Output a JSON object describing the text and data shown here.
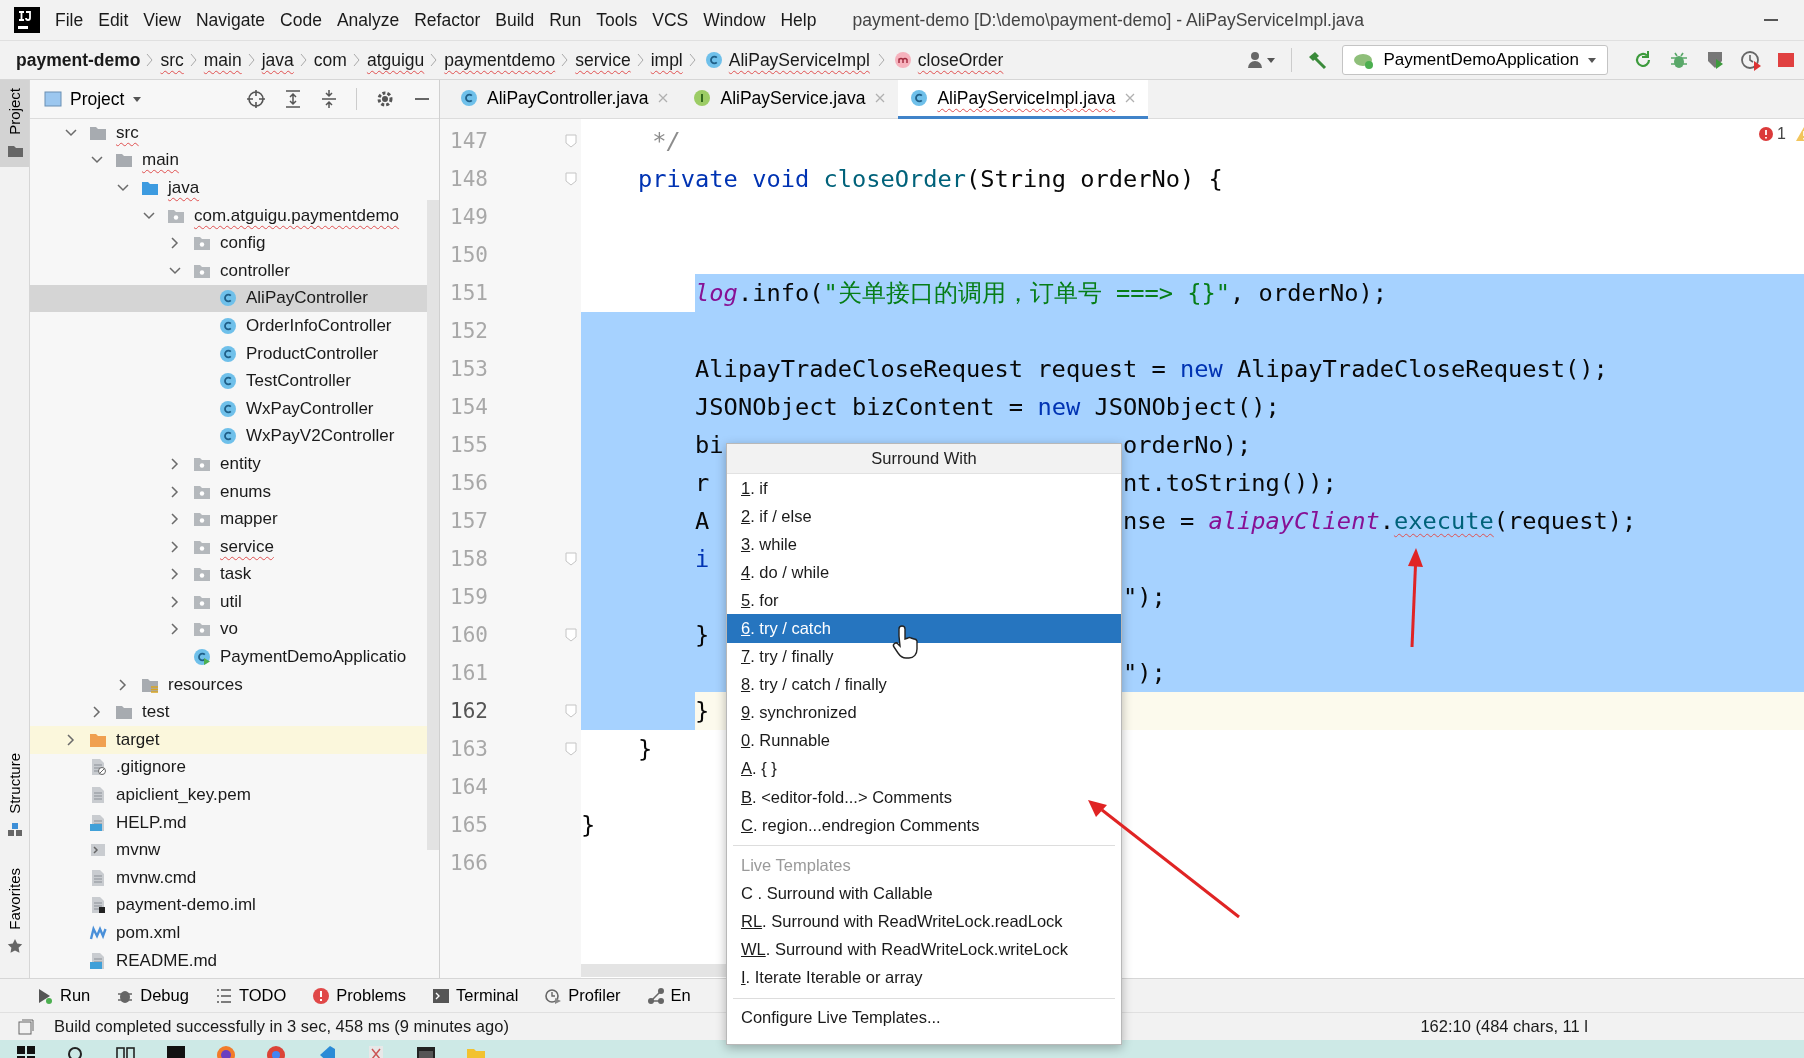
{
  "menu_bar": {
    "items": [
      "File",
      "Edit",
      "View",
      "Navigate",
      "Code",
      "Analyze",
      "Refactor",
      "Build",
      "Run",
      "Tools",
      "VCS",
      "Window",
      "Help"
    ],
    "title": "payment-demo [D:\\demo\\payment-demo] - AliPayServiceImpl.java"
  },
  "breadcrumbs": [
    {
      "label": "payment-demo",
      "kind": "project",
      "underlined": false
    },
    {
      "label": "src",
      "kind": "dir",
      "underlined": true
    },
    {
      "label": "main",
      "kind": "dir",
      "underlined": true
    },
    {
      "label": "java",
      "kind": "dir",
      "underlined": true
    },
    {
      "label": "com",
      "kind": "dir",
      "underlined": false
    },
    {
      "label": "atguigu",
      "kind": "dir",
      "underlined": true
    },
    {
      "label": "paymentdemo",
      "kind": "dir",
      "underlined": true
    },
    {
      "label": "service",
      "kind": "dir",
      "underlined": true
    },
    {
      "label": "impl",
      "kind": "dir",
      "underlined": true
    },
    {
      "label": "AliPayServiceImpl",
      "kind": "class",
      "underlined": true
    },
    {
      "label": "closeOrder",
      "kind": "method",
      "underlined": true
    }
  ],
  "run_config": {
    "label": "PaymentDemoApplication"
  },
  "tool_stripe": [
    {
      "label": "Project",
      "kind": "project",
      "selected": true
    },
    {
      "label": "Structure",
      "kind": "structure",
      "selected": false
    },
    {
      "label": "Favorites",
      "kind": "favorites",
      "selected": false
    }
  ],
  "project_panel": {
    "title": "Project",
    "tree": [
      {
        "label": "src",
        "kind": "folder",
        "expanded": true,
        "selected": false,
        "highlighted": false,
        "underlined": true,
        "children": [
          {
            "label": "main",
            "kind": "folder",
            "expanded": true,
            "selected": false,
            "highlighted": false,
            "underlined": true,
            "children": [
              {
                "label": "java",
                "kind": "source_folder",
                "expanded": true,
                "selected": false,
                "highlighted": false,
                "underlined": true,
                "children": [
                  {
                    "label": "com.atguigu.paymentdemo",
                    "kind": "package",
                    "expanded": true,
                    "selected": false,
                    "highlighted": false,
                    "underlined": true,
                    "children": [
                      {
                        "label": "config",
                        "kind": "package",
                        "expanded": false,
                        "selected": false,
                        "highlighted": false,
                        "underlined": false
                      },
                      {
                        "label": "controller",
                        "kind": "package",
                        "expanded": true,
                        "selected": false,
                        "highlighted": false,
                        "underlined": false,
                        "children": [
                          {
                            "label": "AliPayController",
                            "kind": "class",
                            "selected": true,
                            "highlighted": false,
                            "underlined": false
                          },
                          {
                            "label": "OrderInfoController",
                            "kind": "class",
                            "selected": false,
                            "highlighted": false,
                            "underlined": false
                          },
                          {
                            "label": "ProductController",
                            "kind": "class",
                            "selected": false,
                            "highlighted": false,
                            "underlined": false
                          },
                          {
                            "label": "TestController",
                            "kind": "class",
                            "selected": false,
                            "highlighted": false,
                            "underlined": false
                          },
                          {
                            "label": "WxPayController",
                            "kind": "class",
                            "selected": false,
                            "highlighted": false,
                            "underlined": false
                          },
                          {
                            "label": "WxPayV2Controller",
                            "kind": "class",
                            "selected": false,
                            "highlighted": false,
                            "underlined": false
                          }
                        ]
                      },
                      {
                        "label": "entity",
                        "kind": "package",
                        "expanded": false,
                        "selected": false,
                        "highlighted": false,
                        "underlined": false
                      },
                      {
                        "label": "enums",
                        "kind": "package",
                        "expanded": false,
                        "selected": false,
                        "highlighted": false,
                        "underlined": false
                      },
                      {
                        "label": "mapper",
                        "kind": "package",
                        "expanded": false,
                        "selected": false,
                        "highlighted": false,
                        "underlined": false
                      },
                      {
                        "label": "service",
                        "kind": "package",
                        "expanded": false,
                        "selected": false,
                        "highlighted": false,
                        "underlined": true
                      },
                      {
                        "label": "task",
                        "kind": "package",
                        "expanded": false,
                        "selected": false,
                        "highlighted": false,
                        "underlined": false
                      },
                      {
                        "label": "util",
                        "kind": "package",
                        "expanded": false,
                        "selected": false,
                        "highlighted": false,
                        "underlined": false
                      },
                      {
                        "label": "vo",
                        "kind": "package",
                        "expanded": false,
                        "selected": false,
                        "highlighted": false,
                        "underlined": false
                      },
                      {
                        "label": "PaymentDemoApplicatio",
                        "kind": "app_class",
                        "selected": false,
                        "highlighted": false,
                        "underlined": false
                      }
                    ]
                  }
                ]
              },
              {
                "label": "resources",
                "kind": "resources_folder",
                "expanded": false,
                "selected": false,
                "highlighted": false,
                "underlined": false
              }
            ]
          },
          {
            "label": "test",
            "kind": "folder",
            "expanded": false,
            "selected": false,
            "highlighted": false,
            "underlined": false
          }
        ]
      },
      {
        "label": "target",
        "kind": "excluded_folder",
        "expanded": false,
        "selected": false,
        "highlighted": true,
        "underlined": false
      },
      {
        "label": ".gitignore",
        "kind": "ignore_file",
        "selected": false,
        "highlighted": false,
        "underlined": false
      },
      {
        "label": "apiclient_key.pem",
        "kind": "text_file",
        "selected": false,
        "highlighted": false,
        "underlined": false
      },
      {
        "label": "HELP.md",
        "kind": "markdown_file",
        "selected": false,
        "highlighted": false,
        "underlined": false
      },
      {
        "label": "mvnw",
        "kind": "script_file",
        "selected": false,
        "highlighted": false,
        "underlined": false
      },
      {
        "label": "mvnw.cmd",
        "kind": "text_file",
        "selected": false,
        "highlighted": false,
        "underlined": false
      },
      {
        "label": "payment-demo.iml",
        "kind": "module_file",
        "selected": false,
        "highlighted": false,
        "underlined": false
      },
      {
        "label": "pom.xml",
        "kind": "maven_file",
        "selected": false,
        "highlighted": false,
        "underlined": false
      },
      {
        "label": "README.md",
        "kind": "markdown_file",
        "selected": false,
        "highlighted": false,
        "underlined": false
      }
    ]
  },
  "editor_tabs": [
    {
      "label": "AliPayController.java",
      "kind": "class",
      "selected": false,
      "underlined": false
    },
    {
      "label": "AliPayService.java",
      "kind": "interface",
      "selected": false,
      "underlined": false
    },
    {
      "label": "AliPayServiceImpl.java",
      "kind": "class",
      "selected": true,
      "underlined": true
    }
  ],
  "editor": {
    "problems_count": "1",
    "lines": [
      {
        "number": "147",
        "fold": true,
        "indent_selected": false,
        "text_selected": false,
        "current": false,
        "tokens": [
          {
            "text": "     */",
            "kind": "comment"
          }
        ]
      },
      {
        "number": "148",
        "fold": true,
        "indent_selected": false,
        "text_selected": false,
        "current": false,
        "tokens": [
          {
            "text": "    private",
            "kind": "keyword"
          },
          {
            "text": " void",
            "kind": "keyword"
          },
          {
            "text": " closeOrder",
            "kind": "method"
          },
          {
            "text": "(String orderNo) {",
            "kind": "plain"
          }
        ]
      },
      {
        "number": "149",
        "fold": false,
        "indent_selected": false,
        "text_selected": false,
        "current": false
      },
      {
        "number": "150",
        "fold": false,
        "indent_selected": false,
        "text_selected": false,
        "current": false
      },
      {
        "number": "151",
        "fold": false,
        "indent_selected": false,
        "text_selected": true,
        "current": false,
        "tokens": [
          {
            "text": "        log",
            "kind": "field"
          },
          {
            "text": ".info(",
            "kind": "plain"
          },
          {
            "text": "\"关单接口的调用，订单号 ===> {}\"",
            "kind": "string"
          },
          {
            "text": ", orderNo);",
            "kind": "plain"
          }
        ]
      },
      {
        "number": "152",
        "fold": false,
        "indent_selected": true,
        "text_selected": true,
        "current": false
      },
      {
        "number": "153",
        "fold": false,
        "indent_selected": true,
        "text_selected": true,
        "current": false,
        "tokens": [
          {
            "text": "        AlipayTradeCloseRequest request = ",
            "kind": "plain"
          },
          {
            "text": "new",
            "kind": "keyword"
          },
          {
            "text": " AlipayTradeCloseRequest();",
            "kind": "plain"
          }
        ]
      },
      {
        "number": "154",
        "fold": false,
        "indent_selected": true,
        "text_selected": true,
        "current": false,
        "tokens": [
          {
            "text": "        JSONObject bizContent = ",
            "kind": "plain"
          },
          {
            "text": "new",
            "kind": "keyword"
          },
          {
            "text": " JSONObject();",
            "kind": "plain"
          }
        ]
      },
      {
        "number": "155",
        "fold": false,
        "indent_selected": true,
        "text_selected": true,
        "current": false,
        "tokens": [
          {
            "text": "        bi",
            "kind": "plain"
          },
          {
            "text": "                            orderNo);",
            "kind": "plain"
          }
        ]
      },
      {
        "number": "156",
        "fold": false,
        "indent_selected": true,
        "text_selected": true,
        "current": false,
        "tokens": [
          {
            "text": "        r",
            "kind": "plain"
          },
          {
            "text": "                             nt.toString());",
            "kind": "plain"
          }
        ]
      },
      {
        "number": "157",
        "fold": false,
        "indent_selected": true,
        "text_selected": true,
        "current": false,
        "tokens": [
          {
            "text": "        A",
            "kind": "plain"
          },
          {
            "text": "                             nse = ",
            "kind": "plain"
          },
          {
            "text": "alipayClient",
            "kind": "field"
          },
          {
            "text": ".",
            "kind": "plain"
          },
          {
            "text": "execute",
            "kind": "method_error"
          },
          {
            "text": "(request);",
            "kind": "plain"
          }
        ]
      },
      {
        "number": "158",
        "fold": true,
        "indent_selected": true,
        "text_selected": true,
        "current": false,
        "tokens": [
          {
            "text": "        i",
            "kind": "keyword"
          }
        ]
      },
      {
        "number": "159",
        "fold": false,
        "indent_selected": true,
        "text_selected": true,
        "current": false,
        "tokens": [
          {
            "text": "                                      \");",
            "kind": "plain"
          }
        ]
      },
      {
        "number": "160",
        "fold": true,
        "indent_selected": true,
        "text_selected": true,
        "current": false,
        "tokens": [
          {
            "text": "        }",
            "kind": "plain"
          }
        ]
      },
      {
        "number": "161",
        "fold": false,
        "indent_selected": true,
        "text_selected": true,
        "current": false,
        "tokens": [
          {
            "text": "                                      \");",
            "kind": "plain"
          }
        ]
      },
      {
        "number": "162",
        "fold": true,
        "indent_selected": true,
        "text_selected": false,
        "current": true,
        "tokens": [
          {
            "text": "        }",
            "kind": "plain"
          }
        ]
      },
      {
        "number": "163",
        "fold": true,
        "indent_selected": false,
        "text_selected": false,
        "current": false,
        "tokens": [
          {
            "text": "    }",
            "kind": "plain"
          }
        ]
      },
      {
        "number": "164",
        "fold": false,
        "indent_selected": false,
        "text_selected": false,
        "current": false
      },
      {
        "number": "165",
        "fold": false,
        "text_selected": false,
        "current": false,
        "tokens": [
          {
            "text": "}",
            "kind": "plain"
          }
        ]
      },
      {
        "number": "166",
        "fold": false,
        "indent_selected": false,
        "text_selected": false,
        "current": false
      }
    ]
  },
  "popup": {
    "title": "Surround With",
    "items": [
      {
        "mnemonic": "1",
        "text": ". if",
        "underlined": true,
        "selected": false
      },
      {
        "mnemonic": "2",
        "text": ". if / else",
        "underlined": true,
        "selected": false
      },
      {
        "mnemonic": "3",
        "text": ". while",
        "underlined": true,
        "selected": false
      },
      {
        "mnemonic": "4",
        "text": ". do / while",
        "underlined": true,
        "selected": false
      },
      {
        "mnemonic": "5",
        "text": ". for",
        "underlined": true,
        "selected": false
      },
      {
        "mnemonic": "6",
        "text": ". try / catch",
        "underlined": true,
        "selected": true
      },
      {
        "mnemonic": "7",
        "text": ". try / finally",
        "underlined": true,
        "selected": false
      },
      {
        "mnemonic": "8",
        "text": ". try / catch / finally",
        "underlined": true,
        "selected": false
      },
      {
        "mnemonic": "9",
        "text": ". synchronized",
        "underlined": true,
        "selected": false
      },
      {
        "mnemonic": "0",
        "text": ". Runnable",
        "underlined": true,
        "selected": false
      },
      {
        "mnemonic": "A",
        "text": ". { }",
        "underlined": true,
        "selected": false
      },
      {
        "mnemonic": "B",
        "text": ". <editor-fold...> Comments",
        "underlined": true,
        "selected": false
      },
      {
        "mnemonic": "C",
        "text": ". region...endregion Comments",
        "underlined": true,
        "selected": false
      }
    ],
    "section": "Live Templates",
    "template_items": [
      {
        "mnemonic": "C",
        "text": " . Surround with Callable",
        "underlined": false,
        "selected": false
      },
      {
        "mnemonic": "RL",
        "text": ". Surround with ReadWriteLock.readLock",
        "underlined": true,
        "selected": false
      },
      {
        "mnemonic": "WL",
        "text": ". Surround with ReadWriteLock.writeLock",
        "underlined": true,
        "selected": false
      },
      {
        "mnemonic": "I",
        "text": ". Iterate Iterable or array",
        "underlined": true,
        "selected": false
      }
    ],
    "footer": "Configure Live Templates..."
  },
  "bottom_tools": [
    {
      "label": "Run",
      "kind": "run"
    },
    {
      "label": "Debug",
      "kind": "debug"
    },
    {
      "label": "TODO",
      "kind": "todo"
    },
    {
      "label": "Problems",
      "kind": "problems"
    },
    {
      "label": "Terminal",
      "kind": "terminal"
    },
    {
      "label": "Profiler",
      "kind": "profiler"
    },
    {
      "label": "En",
      "kind": "endpoints"
    }
  ],
  "status_bar": {
    "message": "Build completed successfully in 3 sec, 458 ms (9 minutes ago)",
    "position": "162:10 (484 chars, 11 l"
  }
}
